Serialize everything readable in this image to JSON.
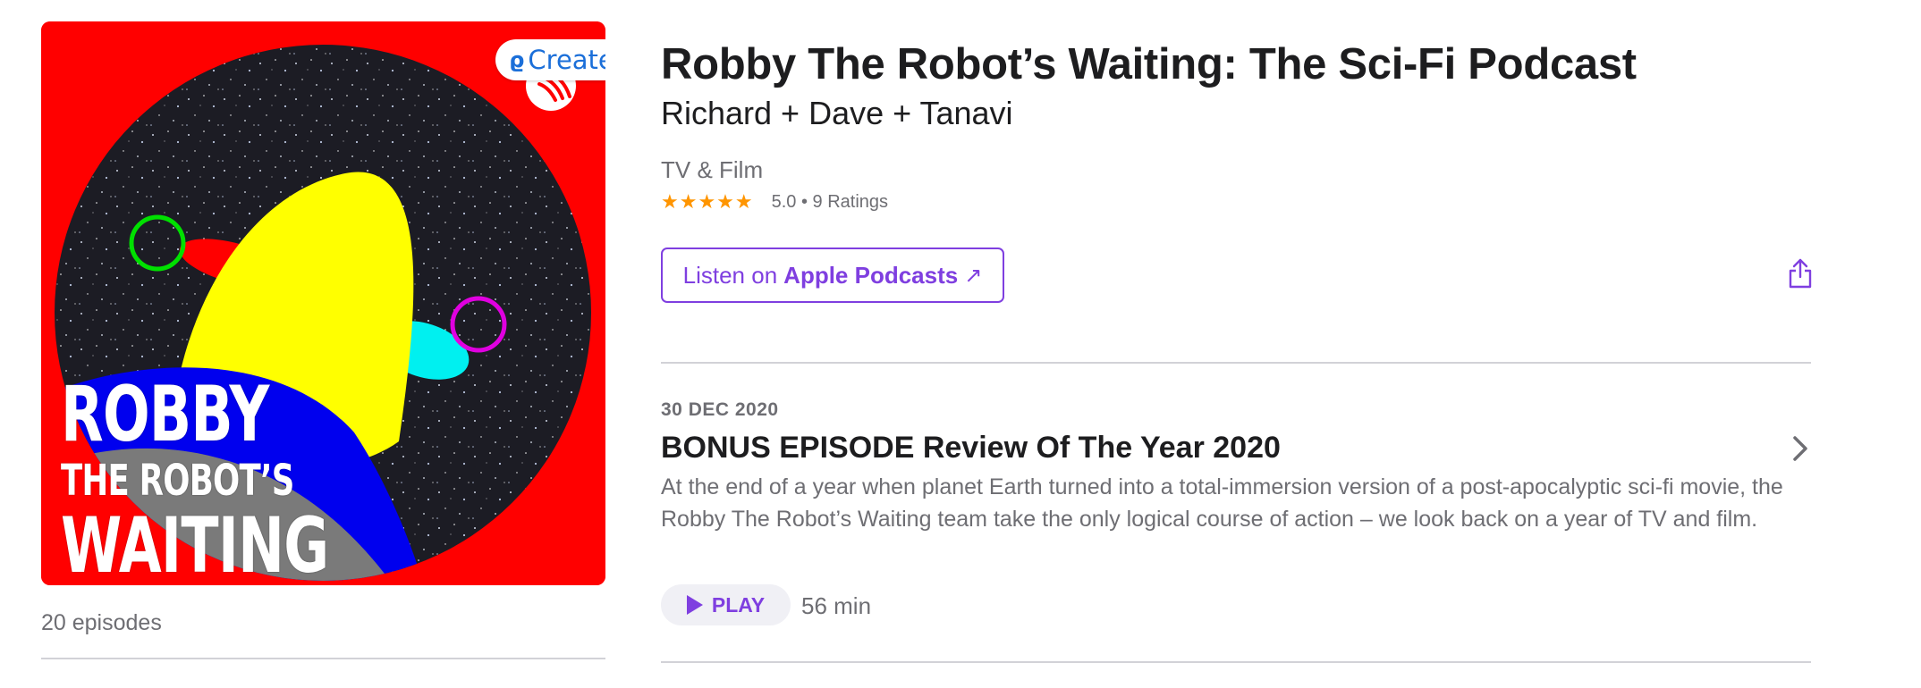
{
  "artwork": {
    "create_label": "Create",
    "line1": "ROBBY",
    "line2": "THE ROBOT’S",
    "line3": "WAITING",
    "colors": {
      "background": "#ff0000",
      "space": "#1a1a22",
      "yellow": "#ffff00",
      "blue": "#0000ee",
      "gray": "#7a7a7a",
      "cyan": "#00f0f0",
      "green_ring": "#00e000",
      "magenta_ring": "#e000e0"
    }
  },
  "sidebar": {
    "episode_count": "20 episodes"
  },
  "header": {
    "title": "Robby The Robot’s Waiting: The Sci-Fi Podcast",
    "author": "Richard + Dave + Tanavi",
    "category": "TV & Film",
    "stars": "★★★★★",
    "rating": "5.0 • 9 Ratings",
    "listen_prefix": "Listen on",
    "listen_strong": "Apple Podcasts",
    "listen_arrow": "↗",
    "share_icon": "share-icon"
  },
  "episode": {
    "date": "30 DEC 2020",
    "title": "BONUS EPISODE Review Of The Year 2020",
    "description": "At the end of a year when planet Earth turned into a total-immersion version of a post-apocalyptic sci-fi movie, the Robby The Robot’s Waiting team take the only logical course of action – we look back on a year of TV and film.",
    "play_label": "PLAY",
    "duration": "56 min"
  },
  "colors": {
    "accent": "#7f3fe0",
    "star": "#ff9500",
    "secondary_text": "#6e6e73",
    "divider": "#d2d2d7"
  }
}
